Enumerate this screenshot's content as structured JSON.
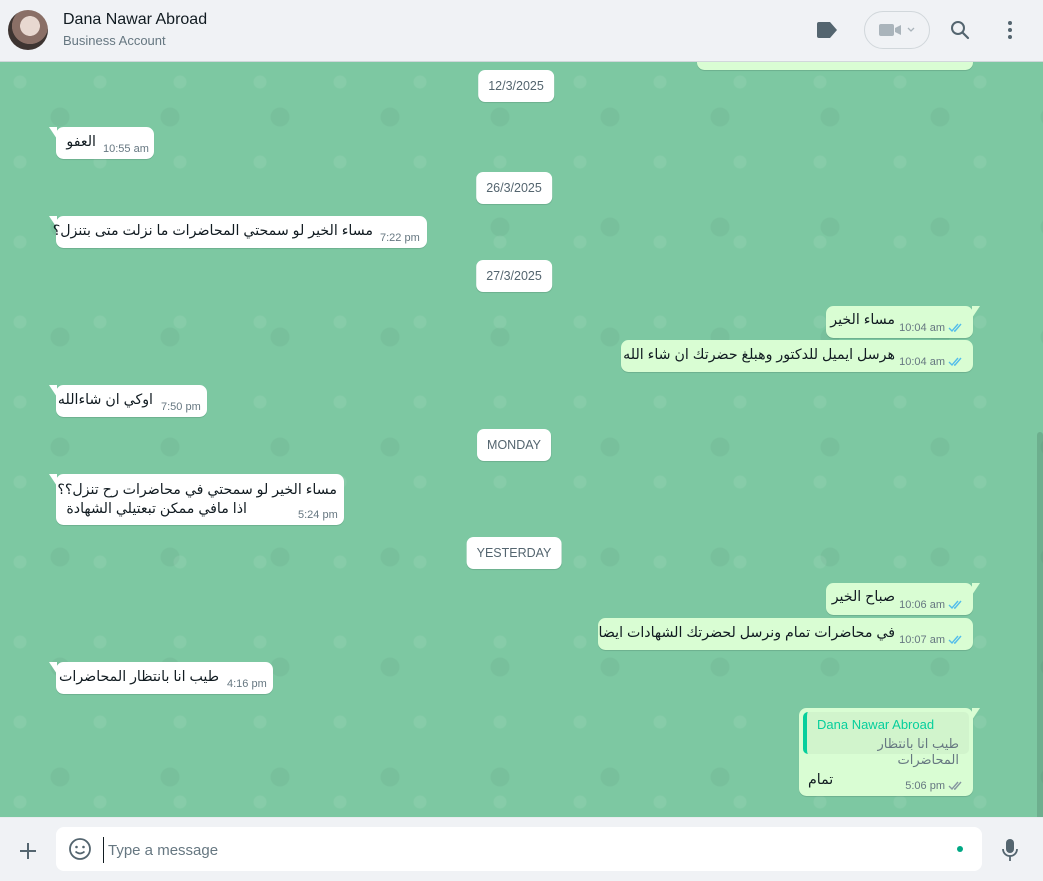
{
  "header": {
    "contact_name": "Dana Nawar Abroad",
    "contact_subtitle": "Business Account",
    "icons": [
      "label-icon",
      "video-call-icon",
      "search-icon",
      "menu-icon"
    ]
  },
  "chat": {
    "dates": {
      "d1": "12/3/2025",
      "d2": "26/3/2025",
      "d3": "27/3/2025",
      "d4": "MONDAY",
      "d5": "YESTERDAY"
    },
    "messages": {
      "m1": {
        "text": "العفو",
        "time": "10:55 am",
        "dir": "in"
      },
      "m2": {
        "text": "مساء الخير لو سمحتي المحاضرات ما نزلت متى بتنزل؟",
        "time": "7:22 pm",
        "dir": "in"
      },
      "m3": {
        "text": "مساء الخير",
        "time": "10:04 am",
        "dir": "out"
      },
      "m4": {
        "text": "هرسل ايميل للدكتور وهبلغ حضرتك ان شاء الله",
        "time": "10:04 am",
        "dir": "out"
      },
      "m5": {
        "text": "اوكي ان شاءالله",
        "time": "7:50 pm",
        "dir": "in"
      },
      "m6": {
        "line1": "مساء الخير لو سمحتي في محاضرات رح تنزل؟؟",
        "line2": "اذا مافي ممكن تبعتيلي الشهادة",
        "time": "5:24 pm",
        "dir": "in"
      },
      "m7": {
        "text": "صباح الخير",
        "time": "10:06 am",
        "dir": "out"
      },
      "m8": {
        "text": "في محاضرات تمام ونرسل لحضرتك الشهادات ايضا",
        "time": "10:07 am",
        "dir": "out"
      },
      "m9": {
        "text": "طيب انا بانتظار المحاضرات",
        "time": "4:16 pm",
        "dir": "in"
      },
      "m10": {
        "quote_name": "Dana Nawar Abroad",
        "quote_text": "طيب انا بانتظار المحاضرات",
        "text": "تمام",
        "time": "5:06 pm",
        "dir": "out"
      }
    }
  },
  "composer": {
    "placeholder": "Type a message"
  },
  "colors": {
    "chat_bg": "#7dc8a2",
    "outgoing_bubble": "#d9fdd3",
    "incoming_bubble": "#ffffff",
    "read_ticks": "#53bdeb",
    "accent": "#00a884"
  }
}
